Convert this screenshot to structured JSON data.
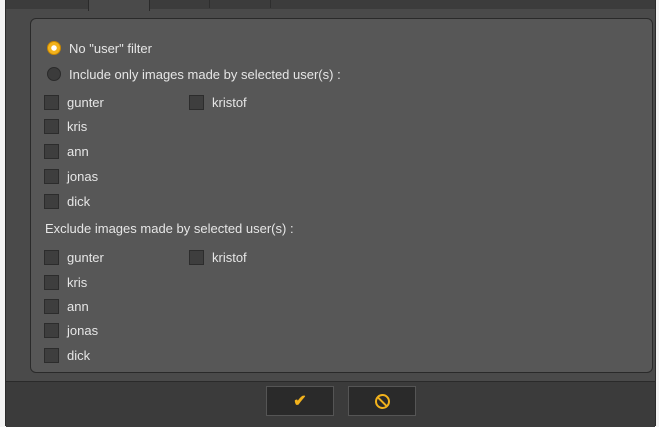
{
  "filter": {
    "no_filter_label": "No \"user\" filter",
    "include_label": "Include only images made by selected user(s) :",
    "exclude_label": "Exclude images made by selected user(s) :",
    "selected_mode": "no_filter"
  },
  "include_users": [
    {
      "name": "gunter",
      "checked": false
    },
    {
      "name": "kristof",
      "checked": false
    },
    {
      "name": "kris",
      "checked": false
    },
    {
      "name": "ann",
      "checked": false
    },
    {
      "name": "jonas",
      "checked": false
    },
    {
      "name": "dick",
      "checked": false
    }
  ],
  "exclude_users": [
    {
      "name": "gunter",
      "checked": false
    },
    {
      "name": "kristof",
      "checked": false
    },
    {
      "name": "kris",
      "checked": false
    },
    {
      "name": "ann",
      "checked": false
    },
    {
      "name": "jonas",
      "checked": false
    },
    {
      "name": "dick",
      "checked": false
    }
  ],
  "buttons": {
    "ok_icon": "checkmark-icon",
    "cancel_icon": "cancel-circle-icon",
    "ok_glyph": "✔"
  },
  "colors": {
    "accent": "#f2b21c",
    "panel": "#575757",
    "background": "#4a4a4a"
  }
}
